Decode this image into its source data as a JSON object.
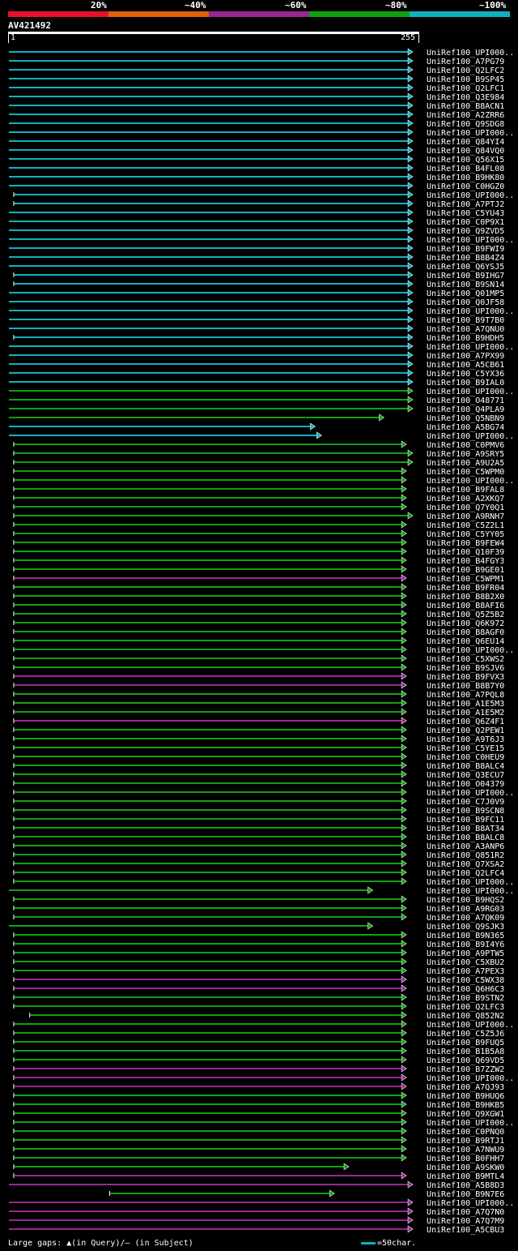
{
  "header": {
    "legend": [
      "20%",
      "~40%",
      "~60%",
      "~80%",
      "~100%"
    ],
    "legend_colors": [
      "#e8102a",
      "#e06010",
      "#962890",
      "#10a010",
      "#10b0c0"
    ],
    "query_id": "AV421492",
    "ruler_start": "1",
    "ruler_end": "255"
  },
  "footer": {
    "gaps_text": "Large gaps: ▲(in Query)/– (in Subject)",
    "scale_text": "=50char."
  },
  "hits": [
    {
      "label": "UniRef100_UPI000..",
      "s": 1,
      "e": 253,
      "c": "cyan"
    },
    {
      "label": "UniRef100_A7PG79",
      "s": 1,
      "e": 253,
      "c": "cyan"
    },
    {
      "label": "UniRef100_Q2LFC2",
      "s": 1,
      "e": 253,
      "c": "cyan"
    },
    {
      "label": "UniRef100_B9SP45",
      "s": 1,
      "e": 253,
      "c": "cyan"
    },
    {
      "label": "UniRef100_Q2LFC1",
      "s": 1,
      "e": 253,
      "c": "cyan"
    },
    {
      "label": "UniRef100_Q3E984",
      "s": 1,
      "e": 253,
      "c": "cyan"
    },
    {
      "label": "UniRef100_B8ACN1",
      "s": 1,
      "e": 253,
      "c": "cyan"
    },
    {
      "label": "UniRef100_A2ZRR6",
      "s": 1,
      "e": 253,
      "c": "cyan"
    },
    {
      "label": "UniRef100_Q9SDG8",
      "s": 1,
      "e": 253,
      "c": "cyan"
    },
    {
      "label": "UniRef100_UPI000..",
      "s": 1,
      "e": 253,
      "c": "cyan"
    },
    {
      "label": "UniRef100_Q84YI4",
      "s": 1,
      "e": 253,
      "c": "cyan"
    },
    {
      "label": "UniRef100_Q84VQ0",
      "s": 1,
      "e": 253,
      "c": "cyan"
    },
    {
      "label": "UniRef100_Q56X15",
      "s": 1,
      "e": 253,
      "c": "cyan"
    },
    {
      "label": "UniRef100_B4FL08",
      "s": 1,
      "e": 253,
      "c": "cyan"
    },
    {
      "label": "UniRef100_B9HK80",
      "s": 1,
      "e": 253,
      "c": "cyan"
    },
    {
      "label": "UniRef100_C0HGZ0",
      "s": 1,
      "e": 253,
      "c": "cyan"
    },
    {
      "label": "UniRef100_UPI000..",
      "s": 4,
      "e": 253,
      "c": "cyan"
    },
    {
      "label": "UniRef100_A7PTJ2",
      "s": 4,
      "e": 253,
      "c": "cyan"
    },
    {
      "label": "UniRef100_C5YU43",
      "s": 1,
      "e": 253,
      "c": "cyan"
    },
    {
      "label": "UniRef100_C0P9X1",
      "s": 1,
      "e": 253,
      "c": "cyan"
    },
    {
      "label": "UniRef100_Q9ZVD5",
      "s": 1,
      "e": 253,
      "c": "cyan"
    },
    {
      "label": "UniRef100_UPI000..",
      "s": 1,
      "e": 253,
      "c": "cyan"
    },
    {
      "label": "UniRef100_B9FWI9",
      "s": 1,
      "e": 253,
      "c": "cyan"
    },
    {
      "label": "UniRef100_B8B4Z4",
      "s": 1,
      "e": 253,
      "c": "cyan"
    },
    {
      "label": "UniRef100_Q6YSJ5",
      "s": 1,
      "e": 253,
      "c": "cyan"
    },
    {
      "label": "UniRef100_B9IHG7",
      "s": 4,
      "e": 253,
      "c": "cyan"
    },
    {
      "label": "UniRef100_B9SN14",
      "s": 4,
      "e": 253,
      "c": "cyan"
    },
    {
      "label": "UniRef100_Q01MP5",
      "s": 1,
      "e": 253,
      "c": "cyan"
    },
    {
      "label": "UniRef100_Q0JF58",
      "s": 1,
      "e": 253,
      "c": "cyan"
    },
    {
      "label": "UniRef100_UPI000..",
      "s": 1,
      "e": 253,
      "c": "cyan"
    },
    {
      "label": "UniRef100_B9T7B0",
      "s": 1,
      "e": 253,
      "c": "cyan"
    },
    {
      "label": "UniRef100_A7QNU0",
      "s": 1,
      "e": 253,
      "c": "cyan"
    },
    {
      "label": "UniRef100_B9HDH5",
      "s": 4,
      "e": 253,
      "c": "cyan"
    },
    {
      "label": "UniRef100_UPI000..",
      "s": 1,
      "e": 253,
      "c": "cyan"
    },
    {
      "label": "UniRef100_A7PX99",
      "s": 1,
      "e": 253,
      "c": "cyan"
    },
    {
      "label": "UniRef100_A5CB61",
      "s": 1,
      "e": 253,
      "c": "cyan"
    },
    {
      "label": "UniRef100_C5YX36",
      "s": 1,
      "e": 253,
      "c": "cyan"
    },
    {
      "label": "UniRef100_B9IAL0",
      "s": 1,
      "e": 253,
      "c": "cyan"
    },
    {
      "label": "UniRef100_UPI000..",
      "s": 1,
      "e": 253,
      "c": "green"
    },
    {
      "label": "UniRef100_O48771",
      "s": 1,
      "e": 253,
      "c": "green"
    },
    {
      "label": "UniRef100_Q4PLA9",
      "s": 1,
      "e": 253,
      "c": "green"
    },
    {
      "label": "UniRef100_Q5NBN9",
      "s": 1,
      "e": 235,
      "c": "green"
    },
    {
      "label": "UniRef100_A5BG74",
      "s": 1,
      "e": 192,
      "c": "cyan"
    },
    {
      "label": "UniRef100_UPI000..",
      "s": 1,
      "e": 196,
      "c": "cyan"
    },
    {
      "label": "UniRef100_C0PMV6",
      "s": 4,
      "e": 249,
      "c": "green"
    },
    {
      "label": "UniRef100_A9SRY5",
      "s": 4,
      "e": 253,
      "c": "green"
    },
    {
      "label": "UniRef100_A9U2A5",
      "s": 4,
      "e": 253,
      "c": "green"
    },
    {
      "label": "UniRef100_C5WPM0",
      "s": 4,
      "e": 249,
      "c": "green"
    },
    {
      "label": "UniRef100_UPI000..",
      "s": 4,
      "e": 249,
      "c": "green"
    },
    {
      "label": "UniRef100_B9FAL8",
      "s": 4,
      "e": 249,
      "c": "green"
    },
    {
      "label": "UniRef100_A2XKQ7",
      "s": 4,
      "e": 249,
      "c": "green"
    },
    {
      "label": "UniRef100_Q7Y0Q1",
      "s": 4,
      "e": 249,
      "c": "green"
    },
    {
      "label": "UniRef100_A9RNH7",
      "s": 4,
      "e": 253,
      "c": "green"
    },
    {
      "label": "UniRef100_C5Z2L1",
      "s": 4,
      "e": 249,
      "c": "green"
    },
    {
      "label": "UniRef100_C5YY05",
      "s": 4,
      "e": 249,
      "c": "green"
    },
    {
      "label": "UniRef100_B9FEW4",
      "s": 4,
      "e": 249,
      "c": "green"
    },
    {
      "label": "UniRef100_Q10F39",
      "s": 4,
      "e": 249,
      "c": "green"
    },
    {
      "label": "UniRef100_B4FGY3",
      "s": 4,
      "e": 249,
      "c": "green"
    },
    {
      "label": "UniRef100_B9GE01",
      "s": 4,
      "e": 249,
      "c": "green"
    },
    {
      "label": "UniRef100_C5WPM1",
      "s": 4,
      "e": 249,
      "c": "purple"
    },
    {
      "label": "UniRef100_B9FR04",
      "s": 4,
      "e": 249,
      "c": "green"
    },
    {
      "label": "UniRef100_B8B2X0",
      "s": 4,
      "e": 249,
      "c": "green"
    },
    {
      "label": "UniRef100_B8AFI6",
      "s": 4,
      "e": 249,
      "c": "green"
    },
    {
      "label": "UniRef100_Q5Z5B2",
      "s": 4,
      "e": 249,
      "c": "green"
    },
    {
      "label": "UniRef100_Q6K972",
      "s": 4,
      "e": 249,
      "c": "green"
    },
    {
      "label": "UniRef100_B8AGF0",
      "s": 4,
      "e": 249,
      "c": "green"
    },
    {
      "label": "UniRef100_Q6EU14",
      "s": 4,
      "e": 249,
      "c": "green"
    },
    {
      "label": "UniRef100_UPI000..",
      "s": 4,
      "e": 249,
      "c": "green"
    },
    {
      "label": "UniRef100_C5XWS2",
      "s": 4,
      "e": 249,
      "c": "green"
    },
    {
      "label": "UniRef100_B9SJV6",
      "s": 4,
      "e": 249,
      "c": "green"
    },
    {
      "label": "UniRef100_B9FVX3",
      "s": 4,
      "e": 249,
      "c": "purple"
    },
    {
      "label": "UniRef100_B8B7Y0",
      "s": 4,
      "e": 249,
      "c": "purple"
    },
    {
      "label": "UniRef100_A7PQL8",
      "s": 4,
      "e": 249,
      "c": "green"
    },
    {
      "label": "UniRef100_A1E5M3",
      "s": 4,
      "e": 249,
      "c": "green"
    },
    {
      "label": "UniRef100_A1E5M2",
      "s": 4,
      "e": 249,
      "c": "green"
    },
    {
      "label": "UniRef100_Q6Z4F1",
      "s": 4,
      "e": 249,
      "c": "purple"
    },
    {
      "label": "UniRef100_Q2PEW1",
      "s": 4,
      "e": 249,
      "c": "green"
    },
    {
      "label": "UniRef100_A9T6J3",
      "s": 4,
      "e": 249,
      "c": "green"
    },
    {
      "label": "UniRef100_C5YE15",
      "s": 4,
      "e": 249,
      "c": "green"
    },
    {
      "label": "UniRef100_C0HEU9",
      "s": 4,
      "e": 249,
      "c": "green"
    },
    {
      "label": "UniRef100_B8ALC4",
      "s": 4,
      "e": 249,
      "c": "green"
    },
    {
      "label": "UniRef100_Q3ECU7",
      "s": 4,
      "e": 249,
      "c": "green"
    },
    {
      "label": "UniRef100_O04379",
      "s": 4,
      "e": 249,
      "c": "green"
    },
    {
      "label": "UniRef100_UPI000..",
      "s": 4,
      "e": 249,
      "c": "green"
    },
    {
      "label": "UniRef100_C7J0V9",
      "s": 4,
      "e": 249,
      "c": "green"
    },
    {
      "label": "UniRef100_B9SCN8",
      "s": 4,
      "e": 249,
      "c": "green"
    },
    {
      "label": "UniRef100_B9FC11",
      "s": 4,
      "e": 249,
      "c": "green"
    },
    {
      "label": "UniRef100_B8AT34",
      "s": 4,
      "e": 249,
      "c": "green"
    },
    {
      "label": "UniRef100_B8ALC8",
      "s": 4,
      "e": 249,
      "c": "green"
    },
    {
      "label": "UniRef100_A3ANP6",
      "s": 4,
      "e": 249,
      "c": "green"
    },
    {
      "label": "UniRef100_Q851R2",
      "s": 4,
      "e": 249,
      "c": "green"
    },
    {
      "label": "UniRef100_Q7XSA2",
      "s": 4,
      "e": 249,
      "c": "green"
    },
    {
      "label": "UniRef100_Q2LFC4",
      "s": 4,
      "e": 249,
      "c": "green"
    },
    {
      "label": "UniRef100_UPI000..",
      "s": 4,
      "e": 249,
      "c": "green"
    },
    {
      "label": "UniRef100_UPI000..",
      "s": 1,
      "e": 228,
      "c": "green"
    },
    {
      "label": "UniRef100_B9HQS2",
      "s": 4,
      "e": 249,
      "c": "green"
    },
    {
      "label": "UniRef100_A9RG03",
      "s": 4,
      "e": 249,
      "c": "green"
    },
    {
      "label": "UniRef100_A7QK09",
      "s": 4,
      "e": 249,
      "c": "green"
    },
    {
      "label": "UniRef100_Q9SJK3",
      "s": 1,
      "e": 228,
      "c": "green"
    },
    {
      "label": "UniRef100_B9N365",
      "s": 4,
      "e": 249,
      "c": "green"
    },
    {
      "label": "UniRef100_B9I4Y6",
      "s": 4,
      "e": 249,
      "c": "green"
    },
    {
      "label": "UniRef100_A9PTW5",
      "s": 4,
      "e": 249,
      "c": "green"
    },
    {
      "label": "UniRef100_C5XBU2",
      "s": 4,
      "e": 249,
      "c": "green"
    },
    {
      "label": "UniRef100_A7PEX3",
      "s": 4,
      "e": 249,
      "c": "green"
    },
    {
      "label": "UniRef100_C5WX38",
      "s": 4,
      "e": 249,
      "c": "purple"
    },
    {
      "label": "UniRef100_Q6H6C3",
      "s": 4,
      "e": 249,
      "c": "purple"
    },
    {
      "label": "UniRef100_B9STN2",
      "s": 4,
      "e": 249,
      "c": "green"
    },
    {
      "label": "UniRef100_Q2LFC3",
      "s": 4,
      "e": 249,
      "c": "green"
    },
    {
      "label": "UniRef100_Q852N2",
      "s": 14,
      "e": 249,
      "c": "green"
    },
    {
      "label": "UniRef100_UPI000..",
      "s": 4,
      "e": 249,
      "c": "green"
    },
    {
      "label": "UniRef100_C5Z5J6",
      "s": 4,
      "e": 249,
      "c": "green"
    },
    {
      "label": "UniRef100_B9FUQ5",
      "s": 4,
      "e": 249,
      "c": "green"
    },
    {
      "label": "UniRef100_B1B5A8",
      "s": 4,
      "e": 249,
      "c": "green"
    },
    {
      "label": "UniRef100_Q69VD5",
      "s": 4,
      "e": 249,
      "c": "green"
    },
    {
      "label": "UniRef100_B7ZZW2",
      "s": 4,
      "e": 249,
      "c": "purple"
    },
    {
      "label": "UniRef100_UPI000..",
      "s": 4,
      "e": 249,
      "c": "purple"
    },
    {
      "label": "UniRef100_A7QJ93",
      "s": 4,
      "e": 249,
      "c": "purple"
    },
    {
      "label": "UniRef100_B9HUQ6",
      "s": 4,
      "e": 249,
      "c": "green"
    },
    {
      "label": "UniRef100_B9HKB5",
      "s": 4,
      "e": 249,
      "c": "green"
    },
    {
      "label": "UniRef100_Q9XGW1",
      "s": 4,
      "e": 249,
      "c": "green"
    },
    {
      "label": "UniRef100_UPI000..",
      "s": 4,
      "e": 249,
      "c": "green"
    },
    {
      "label": "UniRef100_C0PNQ0",
      "s": 4,
      "e": 249,
      "c": "green"
    },
    {
      "label": "UniRef100_B9RTJ1",
      "s": 4,
      "e": 249,
      "c": "green"
    },
    {
      "label": "UniRef100_A7NWU9",
      "s": 4,
      "e": 249,
      "c": "green"
    },
    {
      "label": "UniRef100_B0FHH7",
      "s": 4,
      "e": 249,
      "c": "green"
    },
    {
      "label": "UniRef100_A9SKW0",
      "s": 4,
      "e": 213,
      "c": "green"
    },
    {
      "label": "UniRef100_B9MTL4",
      "s": 4,
      "e": 249,
      "c": "purple"
    },
    {
      "label": "UniRef100_A5B8D3",
      "s": 1,
      "e": 253,
      "c": "purple"
    },
    {
      "label": "UniRef100_B9N7E6",
      "s": 64,
      "e": 204,
      "c": "green"
    },
    {
      "label": "UniRef100_UPI000..",
      "s": 1,
      "e": 253,
      "c": "purple"
    },
    {
      "label": "UniRef100_A7Q7N0",
      "s": 1,
      "e": 253,
      "c": "purple"
    },
    {
      "label": "UniRef100_A7Q7M9",
      "s": 1,
      "e": 253,
      "c": "purple"
    },
    {
      "label": "UniRef100_A5CBU3",
      "s": 1,
      "e": 253,
      "c": "purple"
    }
  ]
}
